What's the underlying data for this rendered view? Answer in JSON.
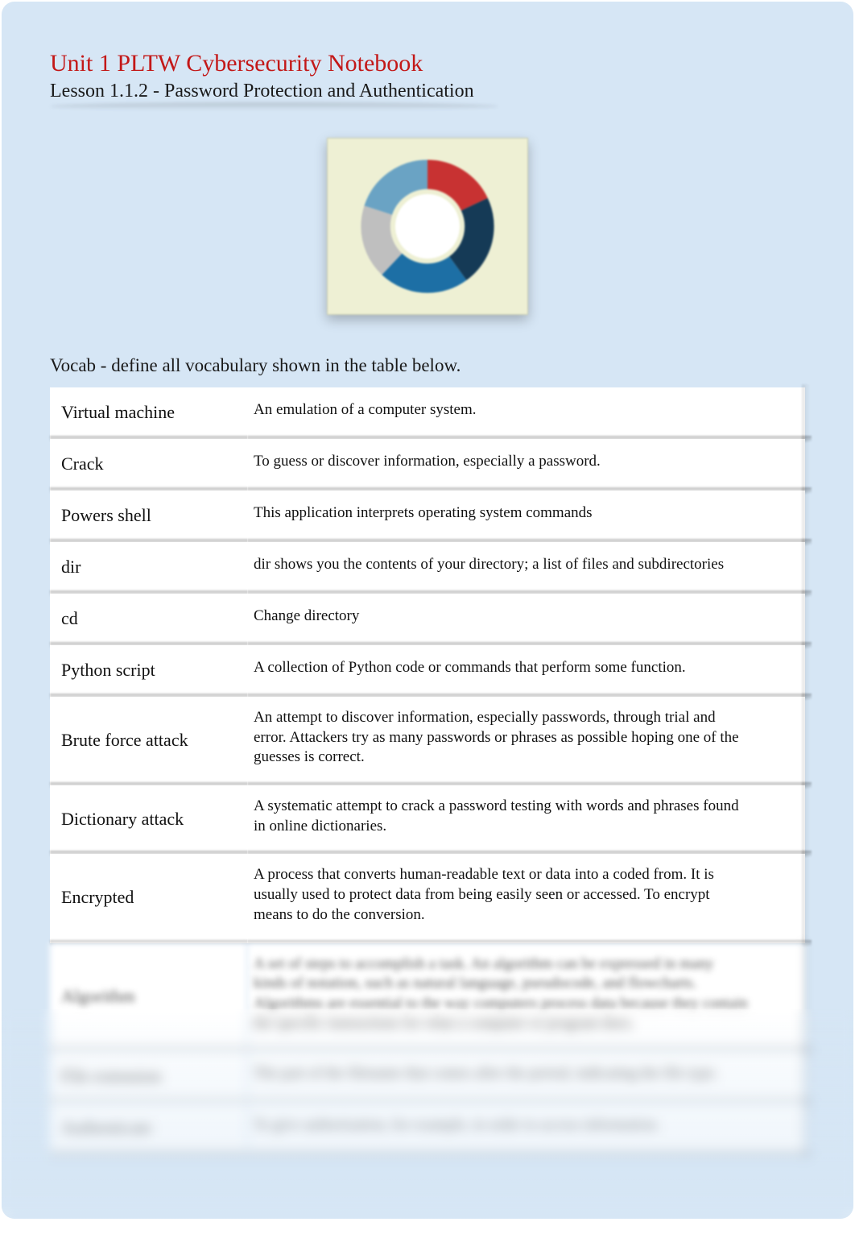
{
  "header": {
    "title": "Unit 1 PLTW Cybersecurity Notebook",
    "subtitle": "Lesson 1.1.2 - Password Protection and Authentication"
  },
  "vocab": {
    "heading": "Vocab - define all vocabulary shown in the table below.",
    "rows": [
      {
        "term": "Virtual machine",
        "definition": "An emulation of a computer system."
      },
      {
        "term": "Crack",
        "definition": "To guess or discover information, especially a password."
      },
      {
        "term": "Powers shell",
        "definition": "This application interprets operating system commands"
      },
      {
        "term": "dir",
        "definition": "dir shows you the contents of your directory; a list of files and subdirectories"
      },
      {
        "term": "cd",
        "definition": "Change directory"
      },
      {
        "term": "Python script",
        "definition": "A collection of Python code or commands that perform some function."
      },
      {
        "term": "Brute force attack",
        "definition": "An attempt to discover information, especially passwords, through trial and error. Attackers try as many passwords or phrases as possible hoping one of the guesses is correct."
      },
      {
        "term": "Dictionary attack",
        "definition": "A systematic attempt to crack a password testing with words and phrases found in online dictionaries."
      },
      {
        "term": "Encrypted",
        "definition": "A process that converts human-readable text or data into a coded from. It is usually used to protect data from being easily seen or accessed. To encrypt means to do the conversion."
      },
      {
        "term": "Algorithm",
        "definition": "A set of steps to accomplish a task. An algorithm can be expressed in many kinds of notation, such as natural language, pseudocode, and flowcharts. Algorithms are essential to the way computers process data because they contain the specific instructions for what a computer or program does."
      },
      {
        "term": "File extension",
        "definition": "The part of the filename that comes after the period, indicating the file type."
      },
      {
        "term": "Authenticate",
        "definition": "To give authorization, for example, in order to access information."
      }
    ]
  },
  "colors": {
    "accent_red": "#c31818",
    "page_bg": "#d6e6f5",
    "hero_bg": "#eef0d4"
  }
}
